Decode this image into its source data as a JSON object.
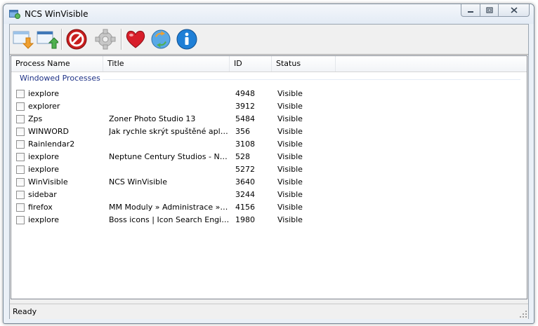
{
  "window": {
    "title": "NCS WinVisible"
  },
  "toolbar": {
    "buttons": [
      {
        "name": "import-icon"
      },
      {
        "name": "export-icon"
      },
      {
        "name": "stop-icon"
      },
      {
        "name": "settings-icon"
      },
      {
        "name": "heart-icon"
      },
      {
        "name": "update-icon"
      },
      {
        "name": "info-icon"
      }
    ]
  },
  "list": {
    "columns": [
      "Process Name",
      "Title",
      "ID",
      "Status"
    ],
    "group_label": "Windowed Processes",
    "rows": [
      {
        "name": "iexplore",
        "title": "",
        "id": "4948",
        "status": "Visible"
      },
      {
        "name": "explorer",
        "title": "",
        "id": "3912",
        "status": "Visible"
      },
      {
        "name": "Zps",
        "title": "Zoner Photo Studio 13",
        "id": "5484",
        "status": "Visible"
      },
      {
        "name": "WINWORD",
        "title": "Jak rychle skrýt spuštěné aplikac...",
        "id": "356",
        "status": "Visible"
      },
      {
        "name": "Rainlendar2",
        "title": "",
        "id": "3108",
        "status": "Visible"
      },
      {
        "name": "iexplore",
        "title": "Neptune Century Studios - Neptu...",
        "id": "528",
        "status": "Visible"
      },
      {
        "name": "iexplore",
        "title": "",
        "id": "5272",
        "status": "Visible"
      },
      {
        "name": "WinVisible",
        "title": "NCS WinVisible",
        "id": "3640",
        "status": "Visible"
      },
      {
        "name": "sidebar",
        "title": "",
        "id": "3244",
        "status": "Visible"
      },
      {
        "name": "firefox",
        "title": "MM Moduly » Administrace » Uži...",
        "id": "4156",
        "status": "Visible"
      },
      {
        "name": "iexplore",
        "title": "Boss icons | Icon Search Engine |...",
        "id": "1980",
        "status": "Visible"
      }
    ]
  },
  "status_bar": {
    "text": "Ready"
  }
}
